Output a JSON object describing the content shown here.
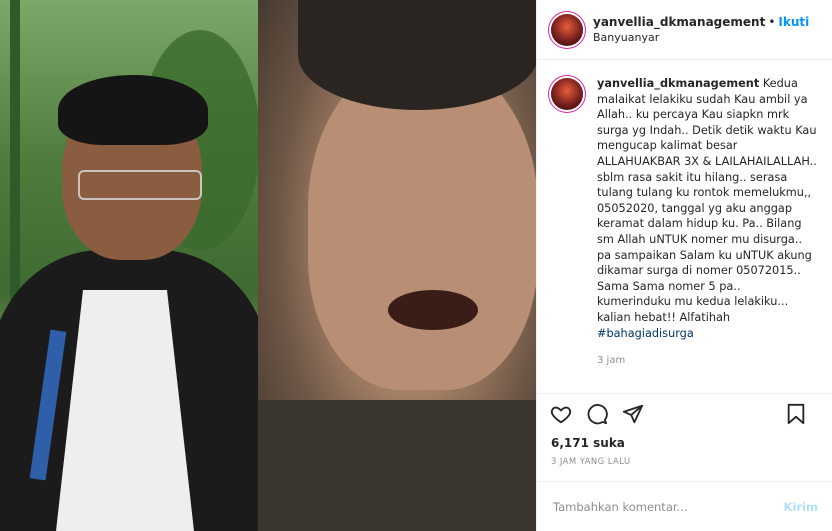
{
  "header": {
    "username": "yanvellia_dkmanagement",
    "separator": "•",
    "follow_label": "Ikuti",
    "location": "Banyuanyar"
  },
  "caption": {
    "username": "yanvellia_dkmanagement",
    "text": "Kedua malaikat lelakiku sudah Kau ambil ya Allah.. ku percaya Kau siapkn mrk surga yg Indah.. Detik detik waktu Kau mengucap kalimat besar ALLAHUAKBAR 3X & LAILAHAILALLAH.. sblm rasa sakit itu hilang.. serasa tulang tulang ku rontok memelukmu,, 05052020, tanggal yg aku anggap keramat dalam hidup ku. Pa.. Bilang sm Allah uNTUK nomer mu disurga.. pa sampaikan Salam ku uNTUK akung dikamar surga di nomer 05072015.. Sama Sama nomer 5 pa.. kumerinduku mu kedua lelakiku... kalian hebat!! Alfatihah",
    "hashtag": "#bahagiadisurga",
    "time": "3 jam"
  },
  "actions": {
    "icons": [
      "heart-icon",
      "comment-icon",
      "share-icon",
      "bookmark-icon"
    ]
  },
  "likes": "6,171 suka",
  "posted_ago": "3 JAM YANG LALU",
  "comment": {
    "placeholder": "Tambahkan komentar...",
    "post_label": "Kirim"
  },
  "colors": {
    "accent": "#0095f6",
    "hashtag": "#00376b",
    "muted": "#8e8e8e",
    "post_disabled": "#b2dffc"
  }
}
